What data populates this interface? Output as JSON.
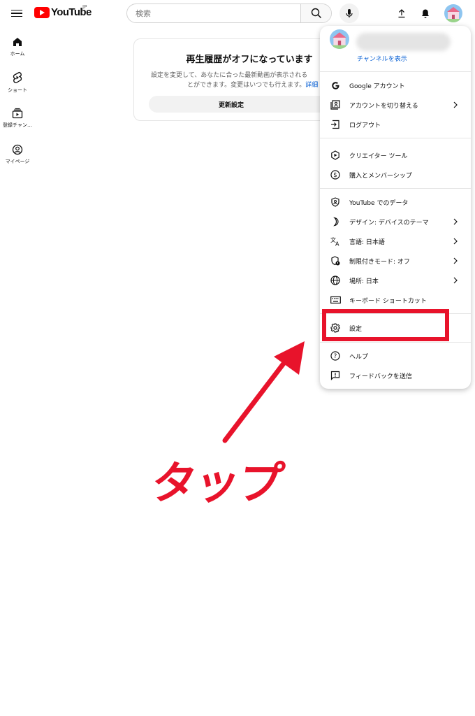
{
  "header": {
    "logo_text": "YouTube",
    "country_code": "JP",
    "search_placeholder": "検索"
  },
  "nav": [
    {
      "label": "ホーム",
      "icon": "home-icon"
    },
    {
      "label": "ショート",
      "icon": "shorts-icon"
    },
    {
      "label": "登録チャン…",
      "icon": "subscriptions-icon"
    },
    {
      "label": "マイページ",
      "icon": "profile-icon"
    }
  ],
  "history_notice": {
    "title": "再生履歴がオフになっています",
    "desc_line1": "設定を変更して、あなたに合った最新動画が表示される",
    "desc_line2": "とができます。変更はいつでも行えます。",
    "desc_link": "詳細",
    "button": "更新設定"
  },
  "account_menu": {
    "channel_link": "チャンネルを表示",
    "sections": [
      [
        {
          "label": "Google アカウント",
          "icon": "google-icon"
        },
        {
          "label": "アカウントを切り替える",
          "icon": "switch-account-icon",
          "chevron": true
        },
        {
          "label": "ログアウト",
          "icon": "logout-icon"
        }
      ],
      [
        {
          "label": "クリエイター ツール",
          "icon": "creator-tools-icon"
        },
        {
          "label": "購入とメンバーシップ",
          "icon": "dollar-icon"
        }
      ],
      [
        {
          "label": "YouTube でのデータ",
          "icon": "data-shield-icon"
        },
        {
          "label": "デザイン: デバイスのテーマ",
          "icon": "theme-moon-icon",
          "chevron": true
        },
        {
          "label": "言語: 日本語",
          "icon": "translate-icon",
          "chevron": true
        },
        {
          "label": "制限付きモード: オフ",
          "icon": "restricted-shield-icon",
          "chevron": true
        },
        {
          "label": "場所: 日本",
          "icon": "globe-icon",
          "chevron": true
        },
        {
          "label": "キーボード ショートカット",
          "icon": "keyboard-icon"
        }
      ],
      [
        {
          "label": "設定",
          "icon": "gear-icon"
        }
      ],
      [
        {
          "label": "ヘルプ",
          "icon": "help-icon"
        },
        {
          "label": "フィードバックを送信",
          "icon": "feedback-icon"
        }
      ]
    ]
  },
  "annotation": {
    "tap_label": "タップ",
    "color": "#e8132b"
  }
}
